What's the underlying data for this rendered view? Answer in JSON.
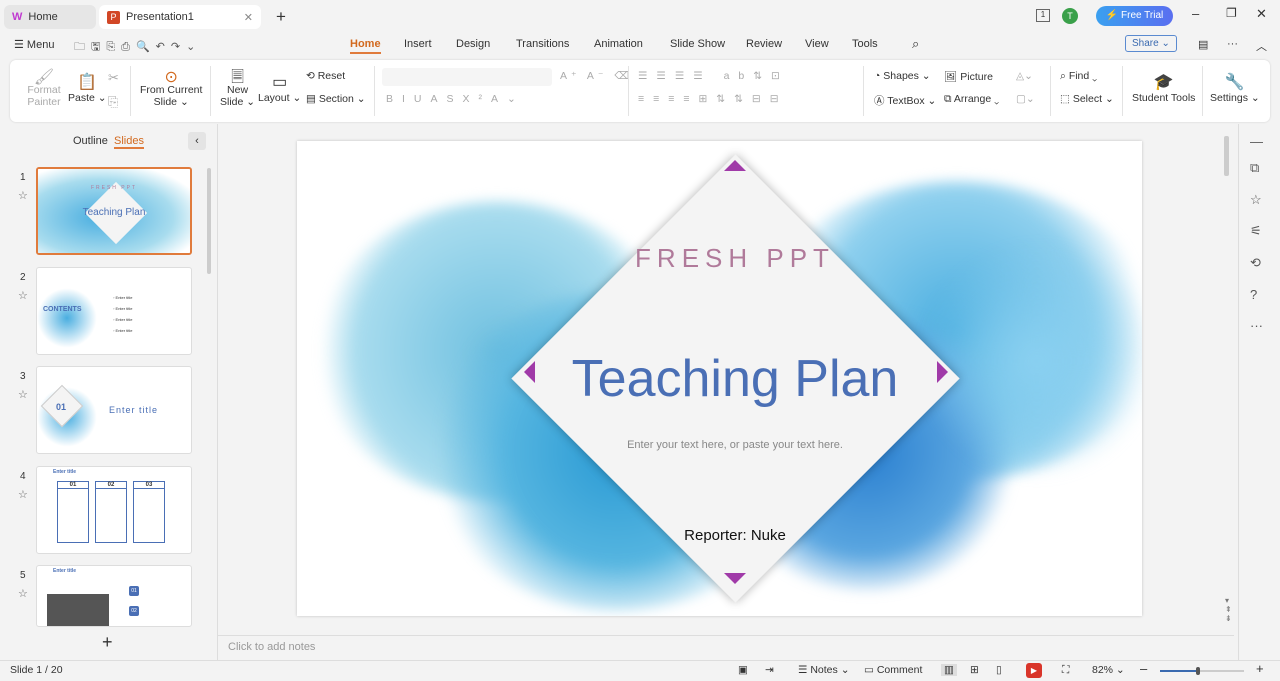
{
  "tabs": {
    "home": "Home",
    "doc": "Presentation1",
    "new": "+"
  },
  "titlebar": {
    "free_trial": "Free Trial",
    "avatar": "T"
  },
  "menu": {
    "label": "Menu",
    "tabs": [
      "Home",
      "Insert",
      "Design",
      "Transitions",
      "Animation",
      "Slide Show",
      "Review",
      "View",
      "Tools"
    ],
    "active": "Home",
    "share": "Share"
  },
  "ribbon": {
    "format_painter": "Format Painter",
    "paste": "Paste",
    "from_current": "From Current",
    "slide": "Slide",
    "new": "New",
    "layout": "Layout",
    "reset": "Reset",
    "section": "Section",
    "shapes": "Shapes",
    "picture": "Picture",
    "textbox": "TextBox",
    "arrange": "Arrange",
    "find": "Find",
    "select": "Select",
    "student_tools": "Student Tools",
    "settings": "Settings"
  },
  "panel": {
    "outline": "Outline",
    "slides": "Slides",
    "active": "Slides"
  },
  "thumbs": [
    {
      "n": "1",
      "title": "Teaching Plan",
      "sub": "FRESH PPT"
    },
    {
      "n": "2",
      "title": "CONTENTS"
    },
    {
      "n": "3",
      "title": "Enter title",
      "badge": "01"
    },
    {
      "n": "4",
      "title": "Enter title",
      "cols": [
        "01",
        "02",
        "03"
      ]
    },
    {
      "n": "5",
      "title": "Enter title",
      "items": [
        "01",
        "02"
      ]
    }
  ],
  "slide": {
    "kicker": "FRESH PPT",
    "title": "Teaching Plan",
    "body": "Enter your text here, or paste your text here.",
    "reporter": "Reporter: Nuke"
  },
  "notes": {
    "placeholder": "Click to add notes"
  },
  "status": {
    "slide": "Slide 1 / 20",
    "notes": "Notes",
    "comment": "Comment",
    "zoom": "82%",
    "zoom_fraction": 0.45
  },
  "colors": {
    "accent": "#e07b3c",
    "title_blue": "#4a6fb5",
    "kicker": "#b07a9a",
    "triangle": "#a03aa8",
    "trial": "#3a8ef0"
  }
}
